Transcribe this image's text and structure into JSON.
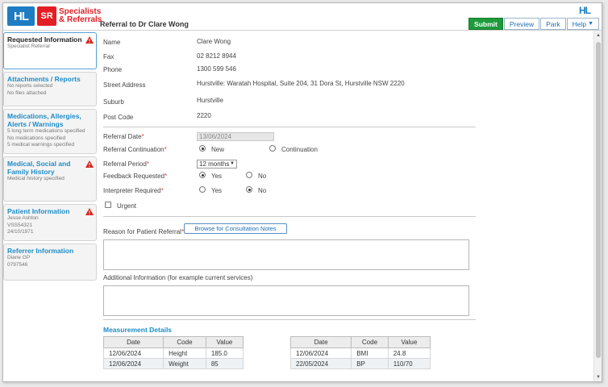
{
  "header": {
    "logo_hl": "HL",
    "logo_sr": "SR",
    "brand_line1": "Specialists",
    "brand_line2": "& Referrals",
    "title": "Referral to Dr Clare Wong",
    "top_icon": "HL"
  },
  "actions": {
    "submit": "Submit",
    "preview": "Preview",
    "park": "Park",
    "help": "Help"
  },
  "sidebar": [
    {
      "title": "Requested Information",
      "lines": [
        "Specialist Referral"
      ],
      "warning": true
    },
    {
      "title": "Attachments / Reports",
      "lines": [
        "No reports selected",
        "No files attached"
      ],
      "warning": false
    },
    {
      "title": "Medications, Allergies, Alerts / Warnings",
      "lines": [
        "5 long term medications specified",
        "No medications specified",
        "5 medical warnings specified"
      ],
      "warning": false
    },
    {
      "title": "Medical, Social and Family History",
      "lines": [
        "Medical history specified"
      ],
      "warning": true
    },
    {
      "title": "Patient Information",
      "lines": [
        "Jesse Ashton",
        "VSS54321",
        "24/10/1971"
      ],
      "warning": true
    },
    {
      "title": "Referrer Information",
      "lines": [
        "Diane GP",
        "0797546"
      ],
      "warning": false
    }
  ],
  "details": {
    "name_label": "Name",
    "name_value": "Clare Wong",
    "fax_label": "Fax",
    "fax_value": "02 8212 8944",
    "phone_label": "Phone",
    "phone_value": "1300 599 546",
    "street_label": "Street Address",
    "street_value": "Hurstville: Waratah Hospital, Suite 204, 31 Dora St, Hurstville NSW 2220",
    "suburb_label": "Suburb",
    "suburb_value": "Hurstville",
    "postcode_label": "Post Code",
    "postcode_value": "2220"
  },
  "form": {
    "referral_date_label": "Referral Date",
    "referral_date_value": "13/06/2024",
    "continuation_label": "Referral Continuation",
    "opt_new": "New",
    "opt_continuation": "Continuation",
    "period_label": "Referral Period",
    "period_value": "12 months",
    "feedback_label": "Feedback Requested",
    "interpreter_label": "Interpreter Required",
    "yes": "Yes",
    "no": "No",
    "urgent_label": "Urgent",
    "reason_label": "Reason for Patient Referral",
    "browse_button": "Browse for Consultation Notes",
    "additional_label": "Additional Information (for example current services)",
    "required_mark": "*"
  },
  "measurements": {
    "heading": "Measurement Details",
    "columns": [
      "Date",
      "Code",
      "Value"
    ],
    "left_table": [
      [
        "12/06/2024",
        "Height",
        "185.0"
      ],
      [
        "12/06/2024",
        "Weight",
        "85"
      ]
    ],
    "right_table": [
      [
        "12/06/2024",
        "BMI",
        "24.8"
      ],
      [
        "22/05/2024",
        "BP",
        "110/70"
      ]
    ]
  }
}
